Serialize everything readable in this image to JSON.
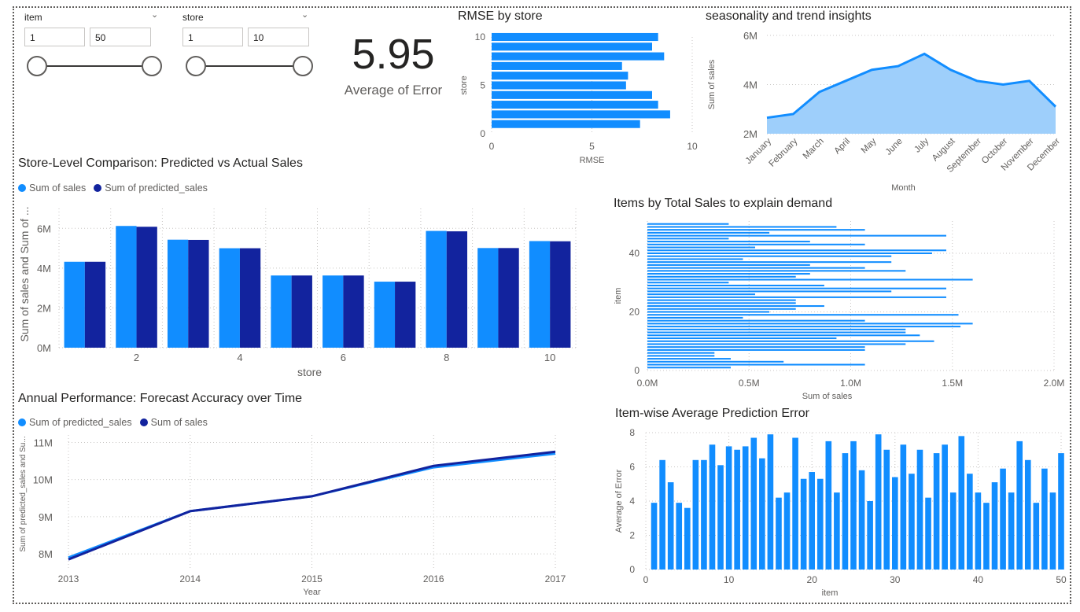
{
  "colors": {
    "primary": "#118DFF",
    "secondary": "#12239E",
    "area": "#9ECFFB",
    "axis": "#605e5c"
  },
  "slicers": [
    {
      "title": "item",
      "min": "1",
      "max": "50"
    },
    {
      "title": "store",
      "min": "1",
      "max": "10"
    }
  ],
  "kpi": {
    "value": "5.95",
    "label": "Average of Error"
  },
  "titles": {
    "rmse": "RMSE by store",
    "season": "seasonality and trend insights",
    "store_cmp": "Store-Level Comparison: Predicted vs Actual Sales",
    "items_sales": "Items by Total Sales to explain demand",
    "annual": "Annual Performance: Forecast Accuracy over Time",
    "item_err": "Item-wise Average Prediction Error"
  },
  "legends": {
    "store_cmp": [
      "Sum of sales",
      "Sum of predicted_sales"
    ],
    "annual": [
      "Sum of predicted_sales",
      "Sum of sales"
    ]
  },
  "chart_data": [
    {
      "id": "rmse",
      "type": "bar",
      "orientation": "horizontal",
      "xlabel": "RMSE",
      "ylabel": "store",
      "xlim": [
        0,
        10
      ],
      "ylim": [
        0,
        10
      ],
      "xticks": [
        "0",
        "5",
        "10"
      ],
      "yticks": [
        "0",
        "5",
        "10"
      ],
      "categories": [
        1,
        2,
        3,
        4,
        5,
        6,
        7,
        8,
        9,
        10
      ],
      "values": [
        7.4,
        8.9,
        8.3,
        8.0,
        6.7,
        6.8,
        6.5,
        8.6,
        8.0,
        8.3
      ]
    },
    {
      "id": "season",
      "type": "area",
      "xlabel": "Month",
      "ylabel": "Sum of sales",
      "ylim": [
        2,
        6
      ],
      "yticks": [
        "2M",
        "4M",
        "6M"
      ],
      "categories": [
        "January",
        "February",
        "March",
        "April",
        "May",
        "June",
        "July",
        "August",
        "September",
        "October",
        "November",
        "December"
      ],
      "values": [
        2.65,
        2.8,
        3.7,
        4.15,
        4.6,
        4.75,
        5.25,
        4.6,
        4.15,
        4.0,
        4.15,
        3.1
      ]
    },
    {
      "id": "store_cmp",
      "type": "bar",
      "xlabel": "store",
      "ylabel": "Sum of sales and Sum of ...",
      "ylim": [
        0,
        7
      ],
      "yticks": [
        "0M",
        "2M",
        "4M",
        "6M"
      ],
      "xticks": [
        "2",
        "4",
        "6",
        "8",
        "10"
      ],
      "categories": [
        1,
        2,
        3,
        4,
        5,
        6,
        7,
        8,
        9,
        10
      ],
      "series": [
        {
          "name": "Sum of sales",
          "values": [
            4.32,
            6.12,
            5.43,
            5.0,
            3.63,
            3.63,
            3.32,
            5.87,
            5.01,
            5.36
          ]
        },
        {
          "name": "Sum of predicted_sales",
          "values": [
            4.32,
            6.08,
            5.42,
            5.0,
            3.63,
            3.63,
            3.32,
            5.85,
            5.01,
            5.35
          ]
        }
      ]
    },
    {
      "id": "items_sales",
      "type": "bar",
      "orientation": "horizontal",
      "xlabel": "Sum of sales",
      "ylabel": "item",
      "xlim": [
        0,
        2
      ],
      "xticks": [
        "0.0M",
        "0.5M",
        "1.0M",
        "1.5M",
        "2.0M"
      ],
      "yticks": [
        "0",
        "20",
        "40"
      ],
      "categories": [
        1,
        2,
        3,
        4,
        5,
        6,
        7,
        8,
        9,
        10,
        11,
        12,
        13,
        14,
        15,
        16,
        17,
        18,
        19,
        20,
        21,
        22,
        23,
        24,
        25,
        26,
        27,
        28,
        29,
        30,
        31,
        32,
        33,
        34,
        35,
        36,
        37,
        38,
        39,
        40,
        41,
        42,
        43,
        44,
        45,
        46,
        47,
        48,
        49,
        50
      ],
      "values": [
        0.41,
        1.07,
        0.67,
        0.41,
        0.33,
        0.33,
        1.07,
        1.07,
        1.27,
        1.41,
        0.93,
        1.34,
        1.27,
        1.27,
        1.54,
        1.6,
        1.07,
        0.47,
        1.53,
        0.6,
        0.73,
        0.87,
        0.73,
        0.73,
        1.47,
        0.53,
        1.2,
        1.47,
        0.87,
        0.4,
        1.6,
        0.73,
        0.8,
        1.27,
        1.07,
        0.8,
        1.2,
        0.47,
        1.2,
        1.4,
        1.47,
        0.53,
        1.07,
        0.8,
        0.4,
        1.47,
        0.6,
        1.07,
        0.93,
        0.4
      ]
    },
    {
      "id": "annual",
      "type": "line",
      "xlabel": "Year",
      "ylabel": "Sum of predicted_sales and Su...",
      "ylim": [
        7.6,
        11.2
      ],
      "yticks": [
        "8M",
        "9M",
        "10M",
        "11M"
      ],
      "categories": [
        "2013",
        "2014",
        "2015",
        "2016",
        "2017"
      ],
      "series": [
        {
          "name": "Sum of predicted_sales",
          "values": [
            7.9,
            9.15,
            9.55,
            10.33,
            10.7
          ]
        },
        {
          "name": "Sum of sales",
          "values": [
            7.85,
            9.15,
            9.55,
            10.37,
            10.75
          ]
        }
      ]
    },
    {
      "id": "item_err",
      "type": "bar",
      "xlabel": "item",
      "ylabel": "Average of Error",
      "ylim": [
        0,
        8
      ],
      "yticks": [
        "0",
        "2",
        "4",
        "6",
        "8"
      ],
      "xticks": [
        "0",
        "10",
        "20",
        "30",
        "40",
        "50"
      ],
      "categories": [
        1,
        2,
        3,
        4,
        5,
        6,
        7,
        8,
        9,
        10,
        11,
        12,
        13,
        14,
        15,
        16,
        17,
        18,
        19,
        20,
        21,
        22,
        23,
        24,
        25,
        26,
        27,
        28,
        29,
        30,
        31,
        32,
        33,
        34,
        35,
        36,
        37,
        38,
        39,
        40,
        41,
        42,
        43,
        44,
        45,
        46,
        47,
        48,
        49,
        50
      ],
      "values": [
        3.9,
        6.4,
        5.1,
        3.9,
        3.6,
        6.4,
        6.4,
        7.3,
        6.1,
        7.2,
        7.0,
        7.2,
        7.7,
        6.5,
        7.9,
        4.2,
        4.5,
        7.7,
        5.3,
        5.7,
        5.3,
        7.5,
        4.5,
        6.8,
        7.5,
        5.8,
        4.0,
        7.9,
        7.0,
        5.4,
        7.3,
        5.6,
        7.0,
        4.2,
        6.8,
        7.3,
        4.5,
        7.8,
        5.6,
        4.5,
        3.9,
        5.1,
        5.9,
        4.5,
        7.5,
        6.4,
        3.9,
        5.9,
        4.5,
        6.8
      ]
    }
  ]
}
